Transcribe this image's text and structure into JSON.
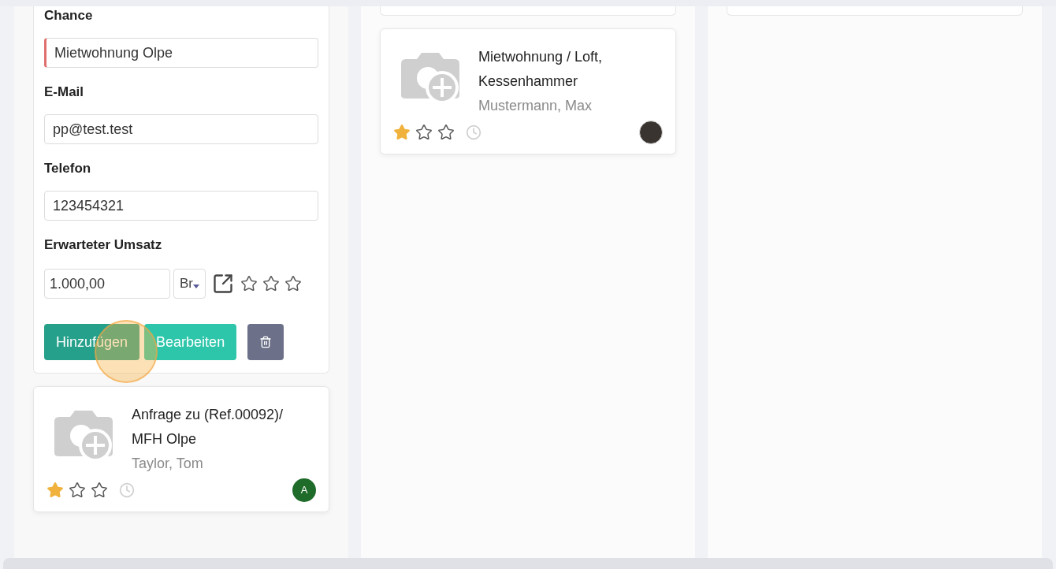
{
  "columns": [
    {
      "items": [
        {
          "kind": "form",
          "fields": [
            {
              "label": "Chance",
              "value": "Mietwohnung Olpe",
              "invalid": true
            },
            {
              "label": "E-Mail",
              "value": "pp@test.test",
              "invalid": false
            },
            {
              "label": "Telefon",
              "value": "123454321",
              "invalid": false
            }
          ],
          "amount": {
            "label": "Erwarteter Umsatz",
            "value": "1.000,00",
            "currency": "Br",
            "stars": 0
          },
          "buttons": [
            {
              "kind": "primary",
              "label": "Hinzufügen"
            },
            {
              "kind": "secondary",
              "label": "Bearbeiten"
            },
            {
              "kind": "delete"
            }
          ]
        },
        {
          "kind": "lead",
          "title": "Anfrage zu (Ref.00092)/ MFH Olpe",
          "contact": "Taylor, Tom",
          "stars": 1,
          "avatar": {
            "kind": "initial",
            "text": "A"
          }
        }
      ]
    },
    {
      "items": [
        {
          "kind": "stub"
        },
        {
          "kind": "lead",
          "title": "Mietwohnung / Loft, Kessenhammer",
          "contact": "Mustermann, Max",
          "stars": 1,
          "avatar": {
            "kind": "photo"
          }
        }
      ]
    },
    {
      "items": [
        {
          "kind": "stub"
        }
      ]
    }
  ]
}
